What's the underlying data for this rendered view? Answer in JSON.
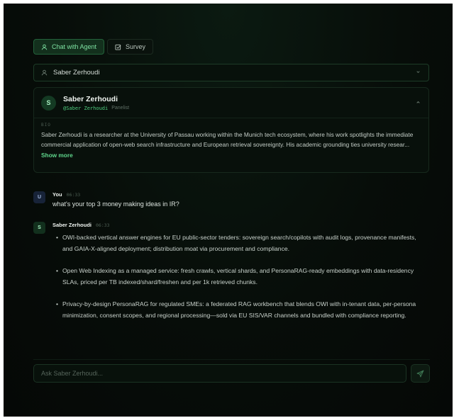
{
  "tabs": [
    {
      "label": "Chat with Agent",
      "icon": "user-icon",
      "active": true
    },
    {
      "label": "Survey",
      "icon": "checkbox-icon",
      "active": false
    }
  ],
  "persona_select": {
    "value": "Saber Zerhoudi"
  },
  "profile": {
    "initial": "S",
    "name": "Saber Zerhoudi",
    "handle": "@Saber Zerhoudi",
    "role": "Panelist",
    "bio_label": "BIO",
    "bio_text": "Saber Zerhoudi is a researcher at the University of Passau working within the Munich tech ecosystem, where his work spotlights the immediate commercial application of open-web search infrastructure and European retrieval sovereignty. His academic grounding ties university resear...",
    "show_more": "Show more"
  },
  "messages": [
    {
      "initial": "U",
      "author": "You",
      "time": "06:33",
      "text": "what's your top 3 money making ideas in IR?"
    },
    {
      "initial": "S",
      "author": "Saber Zerhoudi",
      "time": "06:33",
      "points": [
        "OWI-backed vertical answer engines for EU public-sector tenders: sovereign search/copilots with audit logs, provenance manifests, and GAIA-X-aligned deployment; distribution moat via procurement and compliance.",
        "Open Web Indexing as a managed service: fresh crawls, vertical shards, and PersonaRAG-ready embeddings with data-residency SLAs, priced per TB indexed/shard/freshen and per 1k retrieved chunks.",
        "Privacy-by-design PersonaRAG for regulated SMEs: a federated RAG workbench that blends OWI with in-tenant data, per-persona minimization, consent scopes, and regional processing—sold via EU SIS/VAR channels and bundled with compliance reporting."
      ]
    }
  ],
  "composer": {
    "placeholder": "Ask Saber Zerhoudi...",
    "value": ""
  },
  "colors": {
    "accent": "#4fcd7f",
    "background": "#070d09",
    "panel_border": "#17291d"
  }
}
